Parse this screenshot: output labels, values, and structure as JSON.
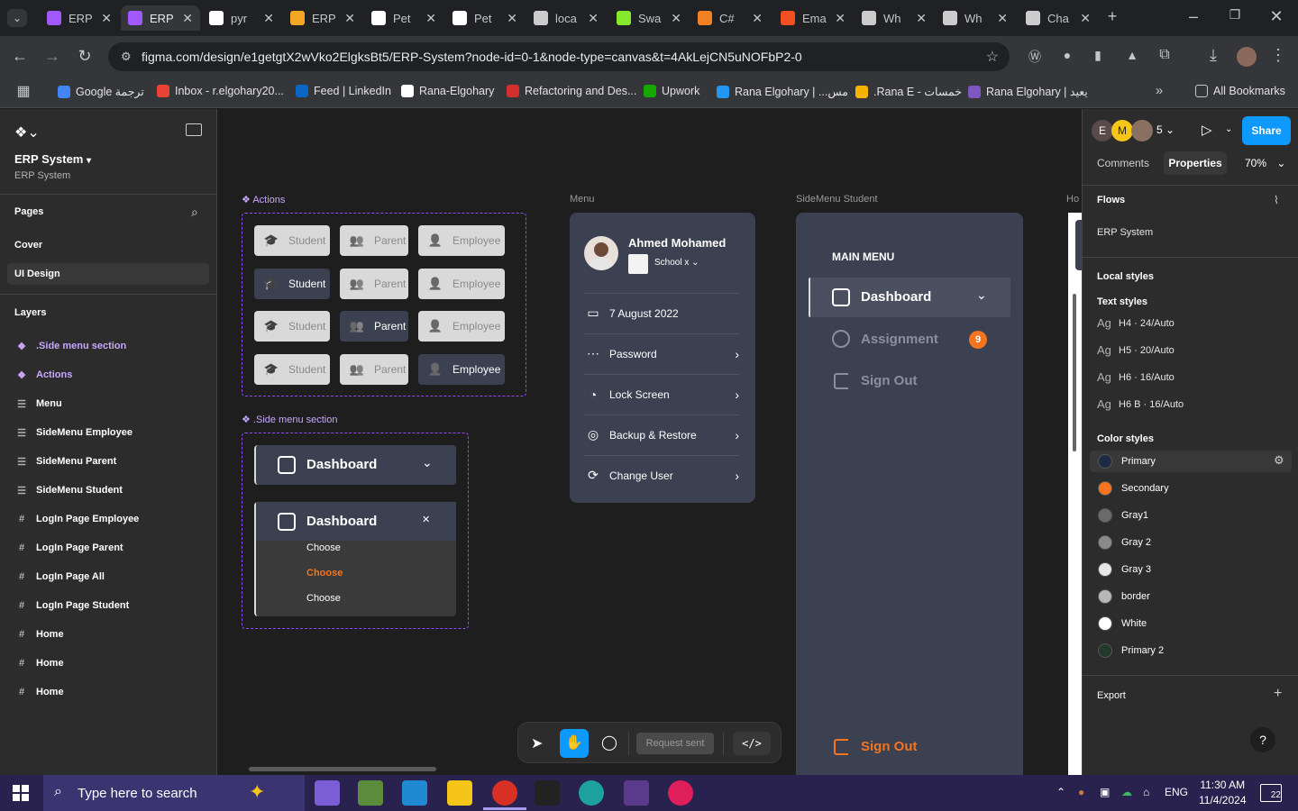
{
  "browser": {
    "tabs": [
      {
        "title": "ERP",
        "color": "#a259ff"
      },
      {
        "title": "ERP",
        "color": "#a259ff",
        "active": true
      },
      {
        "title": "pyr",
        "color": "#ffffff"
      },
      {
        "title": "ERP",
        "color": "#f5a623"
      },
      {
        "title": "Pet",
        "color": "#ffffff"
      },
      {
        "title": "Pet",
        "color": "#ffffff"
      },
      {
        "title": "loca",
        "color": "#cccccc"
      },
      {
        "title": "Swa",
        "color": "#85ea2d"
      },
      {
        "title": "C#",
        "color": "#f48024"
      },
      {
        "title": "Ema",
        "color": "#f25022"
      },
      {
        "title": "Wh",
        "color": "#cccccc"
      },
      {
        "title": "Wh",
        "color": "#cccccc"
      },
      {
        "title": "Cha",
        "color": "#cccccc"
      }
    ],
    "url": "figma.com/design/e1getgtX2wVko2ElgksBt5/ERP-System?node-id=0-1&node-type=canvas&t=4AkLejCN5uNOFbP2-0",
    "bookmarks": [
      {
        "label": "Google ترجمة",
        "color": "#4285f4"
      },
      {
        "label": "Inbox - r.elgohary20...",
        "color": "#ea4335"
      },
      {
        "label": "Feed | LinkedIn",
        "color": "#0a66c2"
      },
      {
        "label": "Rana-Elgohary",
        "color": "#ffffff"
      },
      {
        "label": "Refactoring and Des...",
        "color": "#d32f2f"
      },
      {
        "label": "Upwork",
        "color": "#14a800"
      },
      {
        "label": "Rana Elgohary | ...مس",
        "color": "#2196f3"
      },
      {
        "label": ".Rana E - خمسات",
        "color": "#f5b400"
      },
      {
        "label": "Rana Elgohary | يعيد",
        "color": "#7e57c2"
      }
    ],
    "all_bookmarks": "All Bookmarks"
  },
  "left": {
    "file_title": "ERP System",
    "file_sub": "ERP System",
    "pages_label": "Pages",
    "pages": [
      "Cover",
      "UI Design"
    ],
    "layers_label": "Layers",
    "layers": [
      {
        "label": ".Side menu section",
        "type": "comp"
      },
      {
        "label": "Actions",
        "type": "comp"
      },
      {
        "label": "Menu",
        "type": "frame"
      },
      {
        "label": "SideMenu Employee",
        "type": "frame"
      },
      {
        "label": "SideMenu Parent",
        "type": "frame"
      },
      {
        "label": "SideMenu Student",
        "type": "frame"
      },
      {
        "label": "LogIn Page Employee",
        "type": "grid"
      },
      {
        "label": "LogIn Page Parent",
        "type": "grid"
      },
      {
        "label": "LogIn Page All",
        "type": "grid"
      },
      {
        "label": "LogIn Page Student",
        "type": "grid"
      },
      {
        "label": "Home",
        "type": "grid"
      },
      {
        "label": "Home",
        "type": "grid"
      },
      {
        "label": "Home",
        "type": "grid"
      }
    ]
  },
  "canvas": {
    "actions_label": "Actions",
    "side_section_label": ".Side menu section",
    "menu_label": "Menu",
    "sidemenu_student_label": "SideMenu Student",
    "ho_label": "Ho",
    "roles": [
      "Student",
      "Parent",
      "Employee"
    ],
    "dashboard": "Dashboard",
    "choose_items": [
      "Choose",
      "Choose",
      "Choose"
    ],
    "menu": {
      "name": "Ahmed Mohamed",
      "school": "School x",
      "date": "7 August 2022",
      "items": [
        "Password",
        "Lock Screen",
        "Backup & Restore",
        "Change User"
      ]
    },
    "student": {
      "main_menu": "MAIN MENU",
      "dashboard": "Dashboard",
      "assignment": "Assignment",
      "assignment_badge": "9",
      "sign_out": "Sign Out",
      "sign_out_bottom": "Sign Out"
    },
    "toolbar": {
      "request_sent": "Request sent"
    }
  },
  "right": {
    "avatars": [
      "E",
      "M"
    ],
    "avatar_count": "5",
    "share": "Share",
    "tabs": [
      "Comments",
      "Properties"
    ],
    "zoom": "70%",
    "flows_label": "Flows",
    "flow_item": "ERP System",
    "local_styles": "Local styles",
    "text_styles_label": "Text styles",
    "text_styles": [
      "H4 · 24/Auto",
      "H5 · 20/Auto",
      "H6 · 16/Auto",
      "H6 B · 16/Auto"
    ],
    "ag": "Ag",
    "color_styles_label": "Color styles",
    "colors": [
      {
        "name": "Primary",
        "hex": "#1f2b46"
      },
      {
        "name": "Secondary",
        "hex": "#f47420"
      },
      {
        "name": "Gray1",
        "hex": "#6b6b6b"
      },
      {
        "name": "Gray 2",
        "hex": "#8a8a8a"
      },
      {
        "name": "Gray 3",
        "hex": "#e6e6e6"
      },
      {
        "name": "border",
        "hex": "#b8b8b8"
      },
      {
        "name": "White",
        "hex": "#ffffff"
      },
      {
        "name": "Primary 2",
        "hex": "#22392b"
      }
    ],
    "export_label": "Export",
    "help": "?"
  },
  "taskbar": {
    "search_placeholder": "Type here to search",
    "lang": "ENG",
    "time": "11:30 AM",
    "date": "11/4/2024",
    "notif": "22"
  }
}
